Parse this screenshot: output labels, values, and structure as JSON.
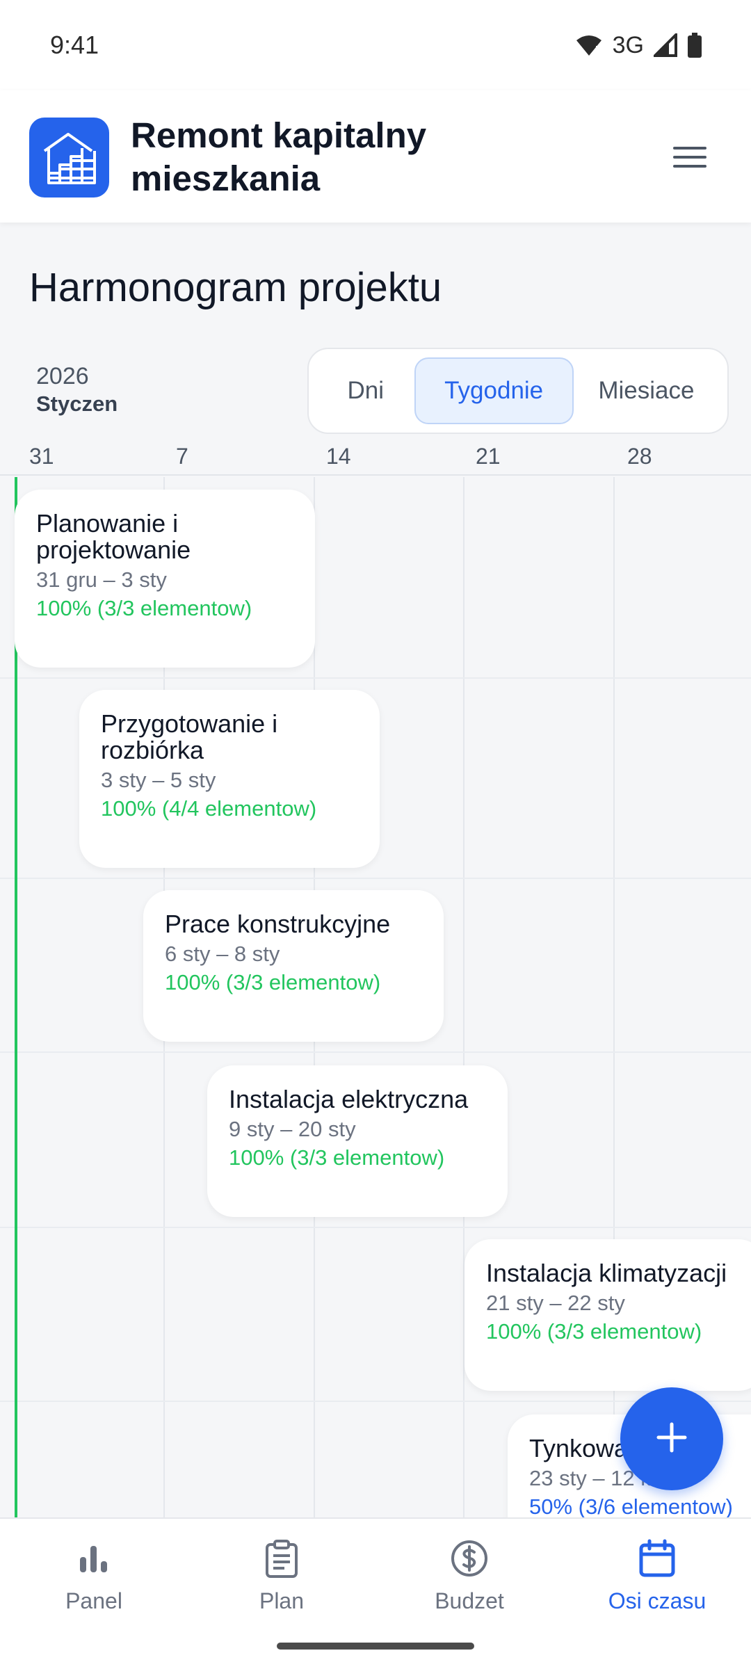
{
  "status_bar": {
    "time": "9:41",
    "network": "3G"
  },
  "header": {
    "title": "Remont kapitalny mieszkania",
    "logo_icon": "building-stairs-icon",
    "menu_icon": "hamburger-menu-icon"
  },
  "page": {
    "title": "Harmonogram projektu"
  },
  "period": {
    "year": "2026",
    "month": "Styczen"
  },
  "view_toggle": {
    "options": [
      "Dni",
      "Tygodnie",
      "Miesiace"
    ],
    "selected": "Tygodnie"
  },
  "axis": {
    "ticks": [
      "31",
      "7",
      "14",
      "21",
      "28"
    ]
  },
  "tasks": [
    {
      "name": "Planowanie i projektowanie",
      "dates": "31 gru – 3 sty",
      "progress": "100% (3/3 elementow)",
      "status": "complete"
    },
    {
      "name": "Przygotowanie i rozbiórka",
      "dates": "3 sty – 5 sty",
      "progress": "100% (4/4 elementow)",
      "status": "complete"
    },
    {
      "name": "Prace konstrukcyjne",
      "dates": "6 sty – 8 sty",
      "progress": "100% (3/3 elementow)",
      "status": "complete"
    },
    {
      "name": "Instalacja elektryczna",
      "dates": "9 sty – 20 sty",
      "progress": "100% (3/3 elementow)",
      "status": "complete"
    },
    {
      "name": "Instalacja klimatyzacji",
      "dates": "21 sty – 22 sty",
      "progress": "100% (3/3 elementow)",
      "status": "complete"
    },
    {
      "name": "Tynkowanie",
      "dates": "23 sty – 12 lut",
      "progress": "50% (3/6 elementow)",
      "status": "in-progress"
    }
  ],
  "fab": {
    "icon": "plus-icon"
  },
  "bottom_nav": {
    "items": [
      {
        "label": "Panel",
        "icon": "bar-chart-icon"
      },
      {
        "label": "Plan",
        "icon": "clipboard-icon"
      },
      {
        "label": "Budzet",
        "icon": "dollar-circle-icon"
      },
      {
        "label": "Osi czasu",
        "icon": "calendar-icon"
      }
    ],
    "active": "Osi czasu"
  },
  "colors": {
    "accent": "#2563eb",
    "complete": "#22c55e",
    "today_line": "#22c55e"
  }
}
